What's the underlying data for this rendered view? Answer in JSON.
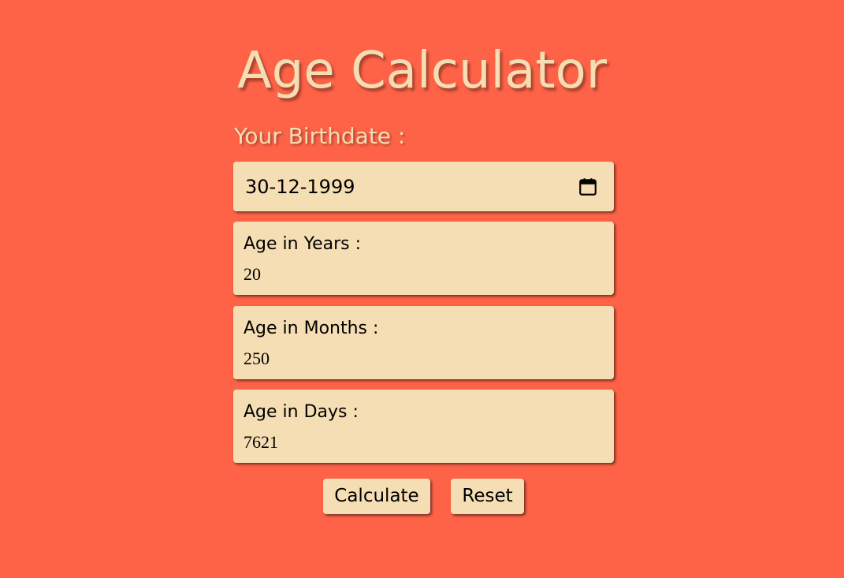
{
  "title": "Age Calculator",
  "birthdate": {
    "label": "Your Birthdate :",
    "value": "30-12-1999",
    "icon": "calendar-icon"
  },
  "results": [
    {
      "label": "Age in Years :",
      "value": "20"
    },
    {
      "label": "Age in Months :",
      "value": "250"
    },
    {
      "label": "Age in Days :",
      "value": "7621"
    }
  ],
  "buttons": {
    "calculate": "Calculate",
    "reset": "Reset"
  },
  "colors": {
    "background": "#ff6347",
    "accent": "#f5deb3",
    "text": "#000000"
  }
}
